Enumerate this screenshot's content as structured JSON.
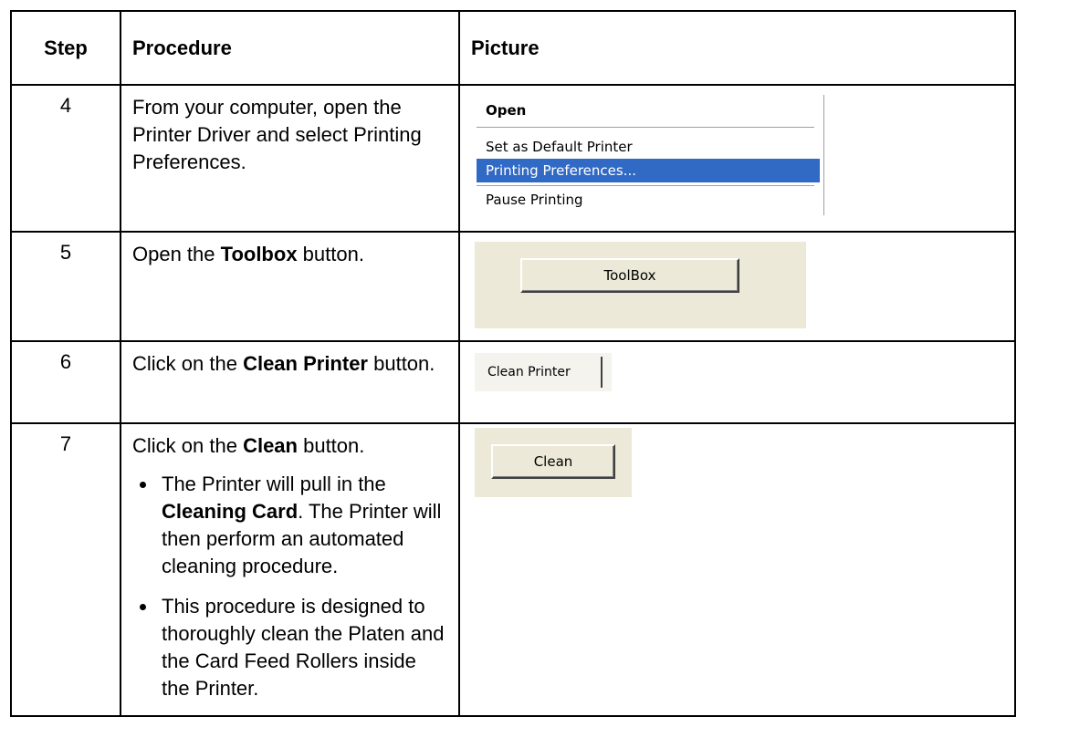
{
  "headers": {
    "step": "Step",
    "procedure": "Procedure",
    "picture": "Picture"
  },
  "rows": [
    {
      "step": "4",
      "procedure": "From your computer, open the Printer Driver and select Printing Preferences.",
      "picture": {
        "menu_items": [
          "Open",
          "Set as Default Printer",
          "Printing Preferences...",
          "Pause Printing"
        ],
        "highlight_color": "#316ac5"
      }
    },
    {
      "step": "5",
      "procedure": {
        "before": "Open the ",
        "bold": "Toolbox",
        "after": " button."
      },
      "picture": {
        "button_label": "ToolBox"
      }
    },
    {
      "step": "6",
      "procedure": {
        "before": "Click on the ",
        "bold": "Clean Printer",
        "after": " button."
      },
      "picture": {
        "tab_label": "Clean Printer"
      }
    },
    {
      "step": "7",
      "procedure": {
        "before": "Click on the ",
        "bold": "Clean",
        "after": " button.",
        "bullets": [
          {
            "before": "The Printer will pull in the ",
            "bold": "Cleaning Card",
            "after": ". The Printer will then perform an automated cleaning procedure."
          },
          {
            "before": "This procedure is designed to thoroughly clean the Platen and the Card Feed Rollers inside the Printer.",
            "bold": "",
            "after": ""
          }
        ]
      },
      "picture": {
        "button_label": "Clean"
      }
    }
  ]
}
